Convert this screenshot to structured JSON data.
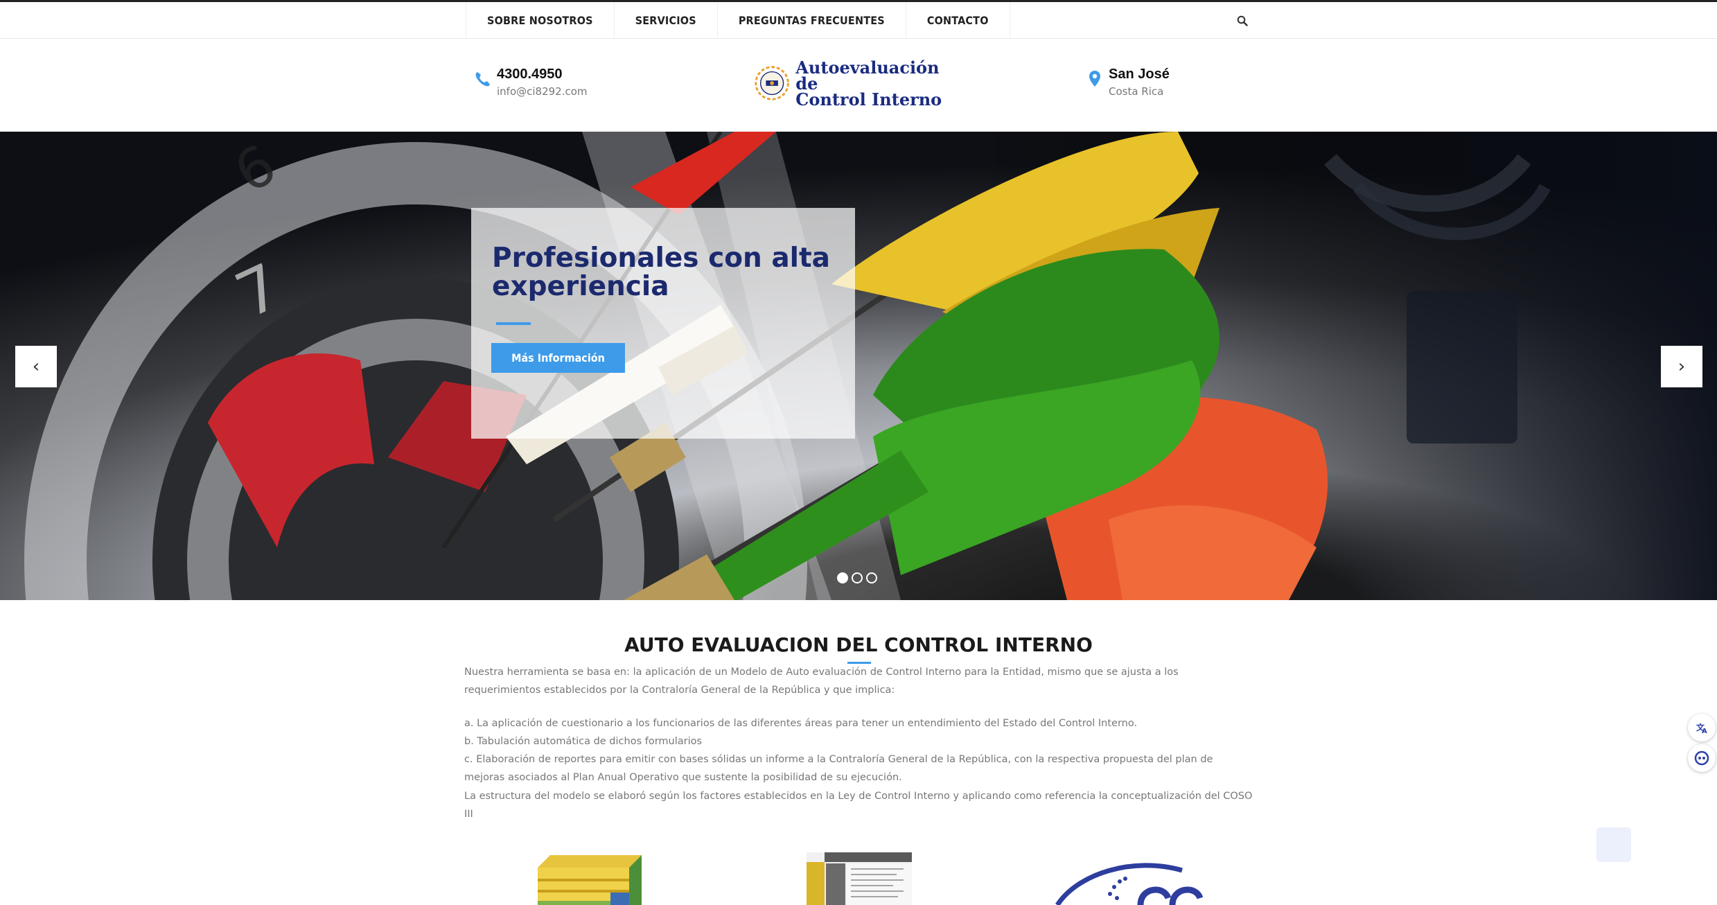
{
  "nav": {
    "items": [
      {
        "label": "SOBRE NOSOTROS"
      },
      {
        "label": "SERVICIOS"
      },
      {
        "label": "PREGUNTAS FRECUENTES"
      },
      {
        "label": "CONTACTO"
      }
    ],
    "search_icon": "search-icon"
  },
  "header": {
    "phone": "4300.4950",
    "email": "info@ci8292.com",
    "logo_line1": "Autoevaluación de",
    "logo_line2": "Control Interno",
    "city": "San José",
    "country": "Costa Rica"
  },
  "hero": {
    "title": "Profesionales con alta experiencia",
    "button_label": "Más Información",
    "prev_label": "‹",
    "next_label": "›",
    "slide_count": 3,
    "active_slide": 1
  },
  "main": {
    "title": "AUTO EVALUACION DEL CONTROL INTERNO",
    "intro": "Nuestra herramienta se basa en: la aplicación de un Modelo de Auto evaluación de Control Interno para la Entidad, mismo que se ajusta a los requerimientos establecidos por la Contraloría General de la República y que implica:",
    "items": [
      "a. La aplicación de cuestionario a los funcionarios de las diferentes áreas para tener un entendimiento del Estado del Control Interno.",
      "b. Tabulación automática de dichos formularios",
      "c. Elaboración de reportes para emitir con bases sólidas un informe a la Contraloría General de la República, con la respectiva propuesta del plan de mejoras asociados al Plan Anual Operativo que sustente la posibilidad de su ejecución.",
      "La estructura del modelo se elaboró según los factores establecidos en la Ley de Control Interno y aplicando como referencia la conceptualización del COSO III"
    ]
  },
  "colors": {
    "accent": "#3d9be9",
    "title_navy": "#1b2a6e",
    "text_gray": "#777777"
  }
}
